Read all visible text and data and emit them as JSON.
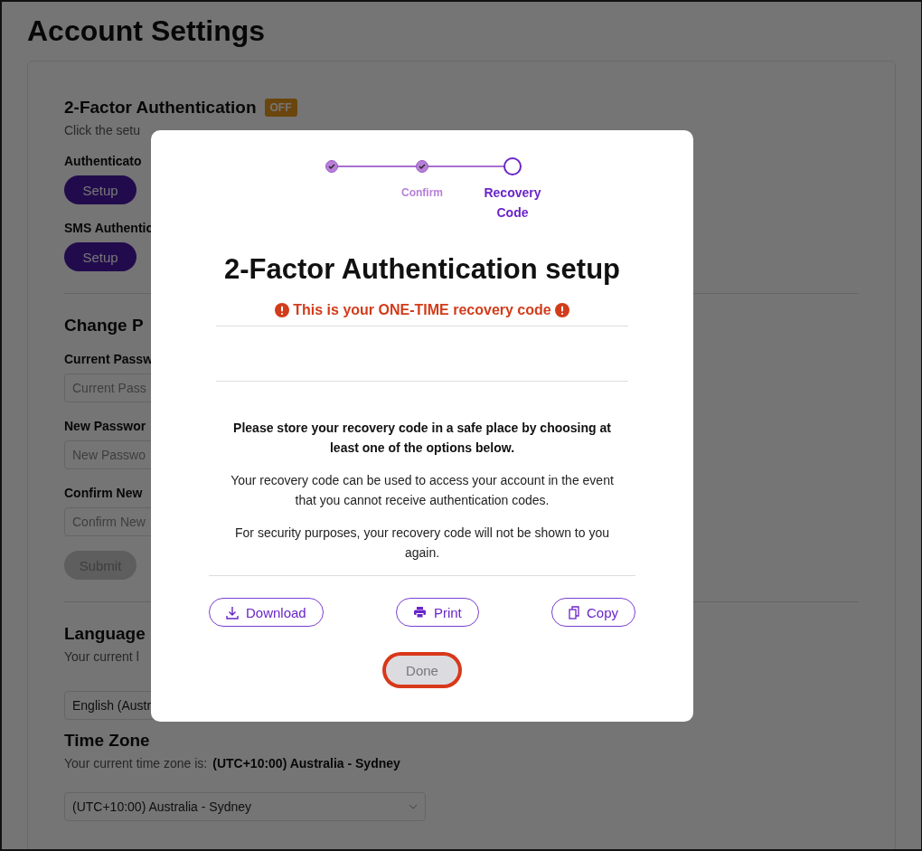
{
  "page": {
    "title": "Account Settings"
  },
  "two_factor": {
    "heading": "2-Factor Authentication",
    "badge": "OFF",
    "hint": "Click the setu",
    "methods": [
      {
        "label": "Authenticato",
        "button": "Setup"
      },
      {
        "label": "SMS Authentic",
        "button": "Setup"
      }
    ]
  },
  "password": {
    "heading": "Change P",
    "fields": [
      {
        "label": "Current Passw",
        "placeholder": "Current Pass"
      },
      {
        "label": "New Passwor",
        "placeholder": "New Passwo"
      },
      {
        "label": "Confirm New",
        "placeholder": "Confirm New"
      }
    ],
    "submit": {
      "label": "Submit",
      "disabled": true
    }
  },
  "language": {
    "heading": "Language",
    "hint": "Your current l",
    "value": "English (Austr"
  },
  "time_zone": {
    "heading": "Time Zone",
    "hint": "Your current time zone is:",
    "current": "(UTC+10:00) Australia - Sydney",
    "value": "(UTC+10:00) Australia - Sydney"
  },
  "dialog": {
    "steps": [
      {
        "completed": true
      },
      {
        "label": "Confirm",
        "completed": true
      },
      {
        "label": "Recovery Code",
        "completed": false
      }
    ],
    "title": "2-Factor Authentication setup",
    "warning": "This is your ONE-TIME recovery code",
    "instruction": "Please store your recovery code in a safe place by choosing at least one of the options below.",
    "notes": [
      "Your recovery code can be used to access your account in the event that you cannot receive authentication codes.",
      "For security purposes, your recovery code will not be shown to you again."
    ],
    "actions": [
      {
        "kind": "download",
        "label": "Download"
      },
      {
        "kind": "print",
        "label": "Print"
      },
      {
        "kind": "copy",
        "label": "Copy"
      }
    ],
    "done": {
      "label": "Done",
      "focused": true,
      "disabled": true
    }
  }
}
